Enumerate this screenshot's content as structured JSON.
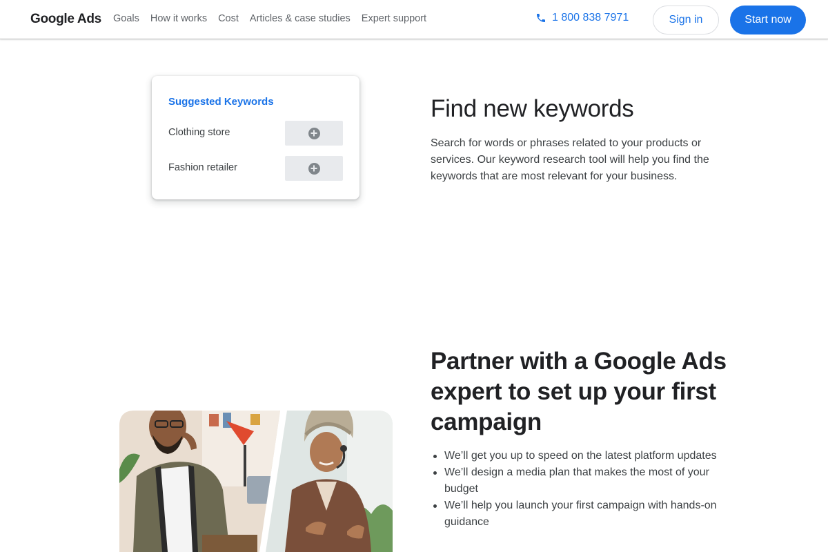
{
  "header": {
    "logo": "Google Ads",
    "nav": [
      "Goals",
      "How it works",
      "Cost",
      "Articles & case studies",
      "Expert support"
    ],
    "phone": "1 800 838 7971",
    "sign_in": "Sign in",
    "start_now": "Start now"
  },
  "keywords_card": {
    "title": "Suggested Keywords",
    "items": [
      "Clothing store",
      "Fashion retailer"
    ]
  },
  "find_section": {
    "heading": "Find new keywords",
    "body": "Search for words or phrases related to your products or services. Our keyword research tool will help you find the keywords that are most relevant for your business."
  },
  "expert_section": {
    "heading": "Partner with a Google Ads expert to set up your first campaign",
    "bullets": [
      "We’ll get you up to speed on the latest platform updates",
      "We’ll design a media plan that makes the most of your budget",
      "We’ll help you launch your first campaign with hands-on guidance"
    ]
  },
  "colors": {
    "accent": "#1a73e8",
    "text": "#202124",
    "muted": "#5f6368"
  }
}
